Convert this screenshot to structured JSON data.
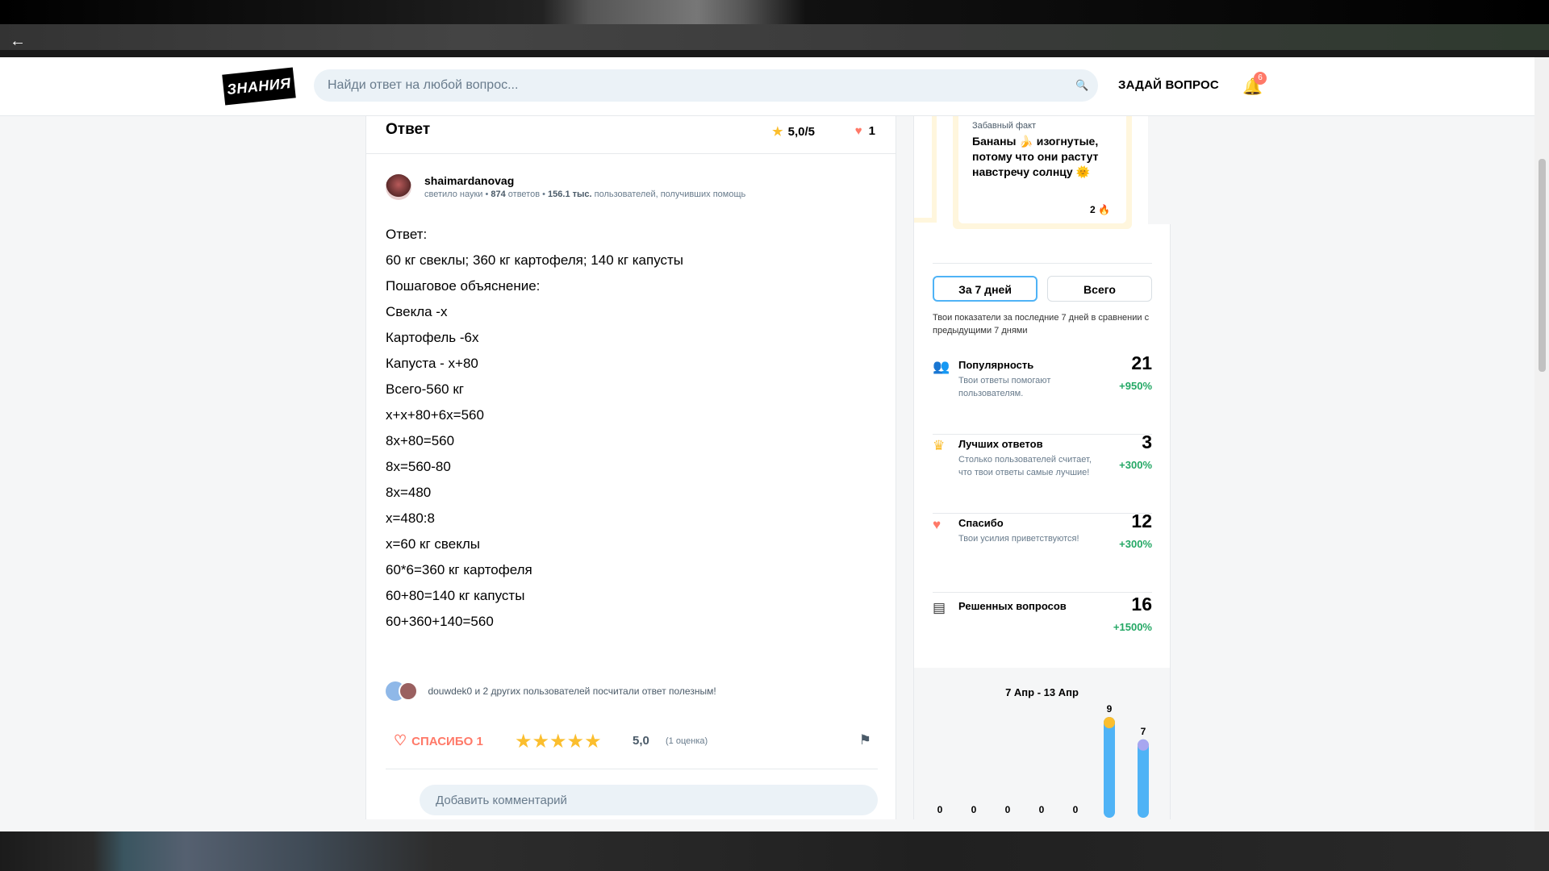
{
  "header": {
    "logo_text": "ЗНАНИЯ",
    "search_placeholder": "Найди ответ на любой вопрос...",
    "ask_button": "ЗАДАЙ ВОПРОС",
    "notifications_count": "6"
  },
  "answer": {
    "title": "Ответ",
    "rating": "5,0/5",
    "likes": "1",
    "author": {
      "name": "shaimardanovag",
      "rank": "светило науки",
      "answers_count": "874",
      "answers_label": "ответов",
      "helped_count": "156.1 тыс.",
      "helped_label": "пользователей, получивших помощь"
    },
    "lines": [
      "Ответ:",
      "60 кг свеклы; 360 кг картофеля; 140 кг капусты",
      "Пошаговое объяснение:",
      "Свекла -х",
      "Картофель -6х",
      "Капуста - х+80",
      "Всего-560 кг",
      "х+х+80+6х=560",
      "8х+80=560",
      "8х=560-80",
      "8х=480",
      "х=480:8",
      "х=60 кг свеклы",
      "60*6=360 кг картофеля",
      "60+80=140 кг капусты",
      "60+360+140=560"
    ],
    "helpful_text": "douwdek0 и 2 других пользователей посчитали ответ полезным!",
    "thanks_label": "СПАСИБО 1",
    "stars": "★★★★★",
    "score": "5,0",
    "score_count": "(1 оценка)",
    "comment_placeholder": "Добавить комментарий"
  },
  "side": {
    "fact_label": "Забавный факт",
    "fact_text": "Бананы 🍌 изогнутые, потому что они растут навстречу солнцу 🌞",
    "fact_count": "2",
    "tab_week": "За 7 дней",
    "tab_all": "Всего",
    "period_note": "Твои показатели за последние 7 дней в сравнении с предыдущими 7 днями",
    "stats": [
      {
        "name": "Популярность",
        "desc": "Твои ответы помогают пользователям.",
        "value": "21",
        "delta": "+950%",
        "icon": "users-icon"
      },
      {
        "name": "Лучших ответов",
        "desc": "Столько пользователей считает, что твои ответы самые лучшие!",
        "value": "3",
        "delta": "+300%",
        "icon": "crown-icon"
      },
      {
        "name": "Спасибо",
        "desc": "Твои усилия приветствуются!",
        "value": "12",
        "delta": "+300%",
        "icon": "heart-icon"
      },
      {
        "name": "Решенных вопросов",
        "desc": "",
        "value": "16",
        "delta": "+1500%",
        "icon": "document-icon"
      }
    ],
    "chart_title": "7 Апр - 13 Апр"
  },
  "colors": {
    "accent_blue": "#4fb3f6",
    "heart": "#ff7968",
    "star": "#fbbe2e",
    "positive": "#24a865"
  },
  "chart_data": {
    "type": "bar",
    "categories": [
      "",
      "",
      "",
      "",
      "",
      "",
      ""
    ],
    "values": [
      0,
      0,
      0,
      0,
      0,
      9,
      7
    ],
    "title": "7 Апр - 13 Апр",
    "xlabel": "",
    "ylabel": "",
    "ylim": [
      0,
      9
    ]
  }
}
